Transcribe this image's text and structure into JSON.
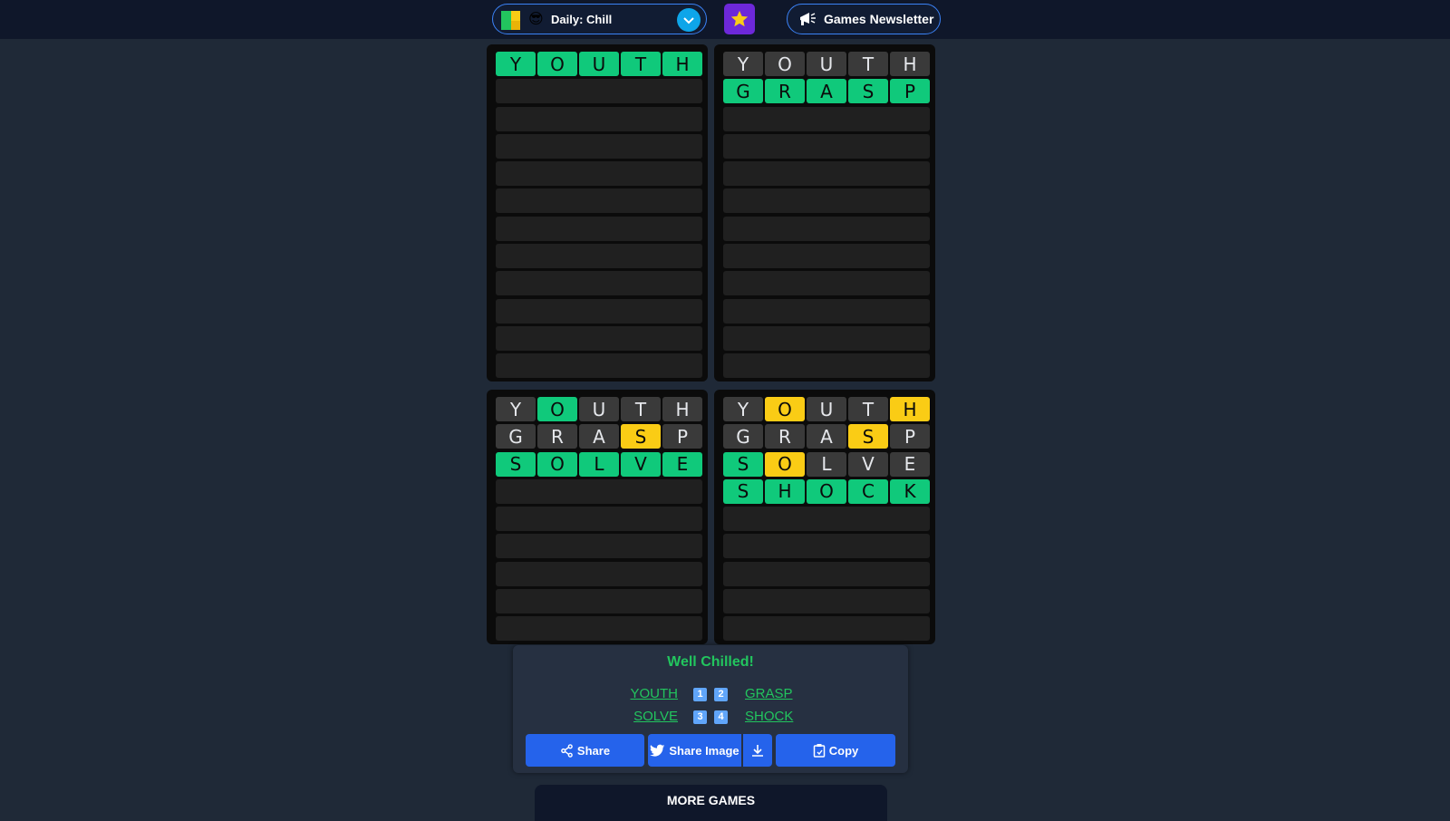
{
  "header": {
    "mode_emoji": "😎",
    "mode_label": "Daily: Chill",
    "newsletter_label": "Games Newsletter",
    "icons": {
      "logo": "game-logo-icon",
      "dropdown": "chevron-down-icon",
      "favorite": "star-icon",
      "newsletter": "megaphone-icon"
    }
  },
  "boards": [
    {
      "name": "board-1",
      "total_rows": 12,
      "guesses": [
        {
          "letters": [
            "Y",
            "O",
            "U",
            "T",
            "H"
          ],
          "states": [
            "g",
            "g",
            "g",
            "g",
            "g"
          ]
        }
      ]
    },
    {
      "name": "board-2",
      "total_rows": 12,
      "guesses": [
        {
          "letters": [
            "Y",
            "O",
            "U",
            "T",
            "H"
          ],
          "states": [
            "x",
            "x",
            "x",
            "x",
            "x"
          ]
        },
        {
          "letters": [
            "G",
            "R",
            "A",
            "S",
            "P"
          ],
          "states": [
            "g",
            "g",
            "g",
            "g",
            "g"
          ]
        }
      ]
    },
    {
      "name": "board-3",
      "total_rows": 9,
      "guesses": [
        {
          "letters": [
            "Y",
            "O",
            "U",
            "T",
            "H"
          ],
          "states": [
            "x",
            "g",
            "x",
            "x",
            "x"
          ]
        },
        {
          "letters": [
            "G",
            "R",
            "A",
            "S",
            "P"
          ],
          "states": [
            "x",
            "x",
            "x",
            "y",
            "x"
          ]
        },
        {
          "letters": [
            "S",
            "O",
            "L",
            "V",
            "E"
          ],
          "states": [
            "g",
            "g",
            "g",
            "g",
            "g"
          ]
        }
      ]
    },
    {
      "name": "board-4",
      "total_rows": 9,
      "guesses": [
        {
          "letters": [
            "Y",
            "O",
            "U",
            "T",
            "H"
          ],
          "states": [
            "x",
            "y",
            "x",
            "x",
            "y"
          ]
        },
        {
          "letters": [
            "G",
            "R",
            "A",
            "S",
            "P"
          ],
          "states": [
            "x",
            "x",
            "x",
            "y",
            "x"
          ]
        },
        {
          "letters": [
            "S",
            "O",
            "L",
            "V",
            "E"
          ],
          "states": [
            "g",
            "y",
            "x",
            "x",
            "x"
          ]
        },
        {
          "letters": [
            "S",
            "H",
            "O",
            "C",
            "K"
          ],
          "states": [
            "g",
            "g",
            "g",
            "g",
            "g"
          ]
        }
      ]
    }
  ],
  "colors": {
    "correct": "#10c97b",
    "present": "#facc15",
    "absent": "#3a3a3a",
    "button": "#2563eb"
  },
  "result": {
    "title": "Well Chilled!",
    "rows": [
      {
        "left_word": "YOUTH",
        "n1": "1",
        "n2": "2",
        "right_word": "GRASP"
      },
      {
        "left_word": "SOLVE",
        "n1": "3",
        "n2": "4",
        "right_word": "SHOCK"
      }
    ],
    "share_label": "Share",
    "share_image_label": "Share Image",
    "copy_label": "Copy"
  },
  "more_games": {
    "title": "MORE GAMES"
  }
}
